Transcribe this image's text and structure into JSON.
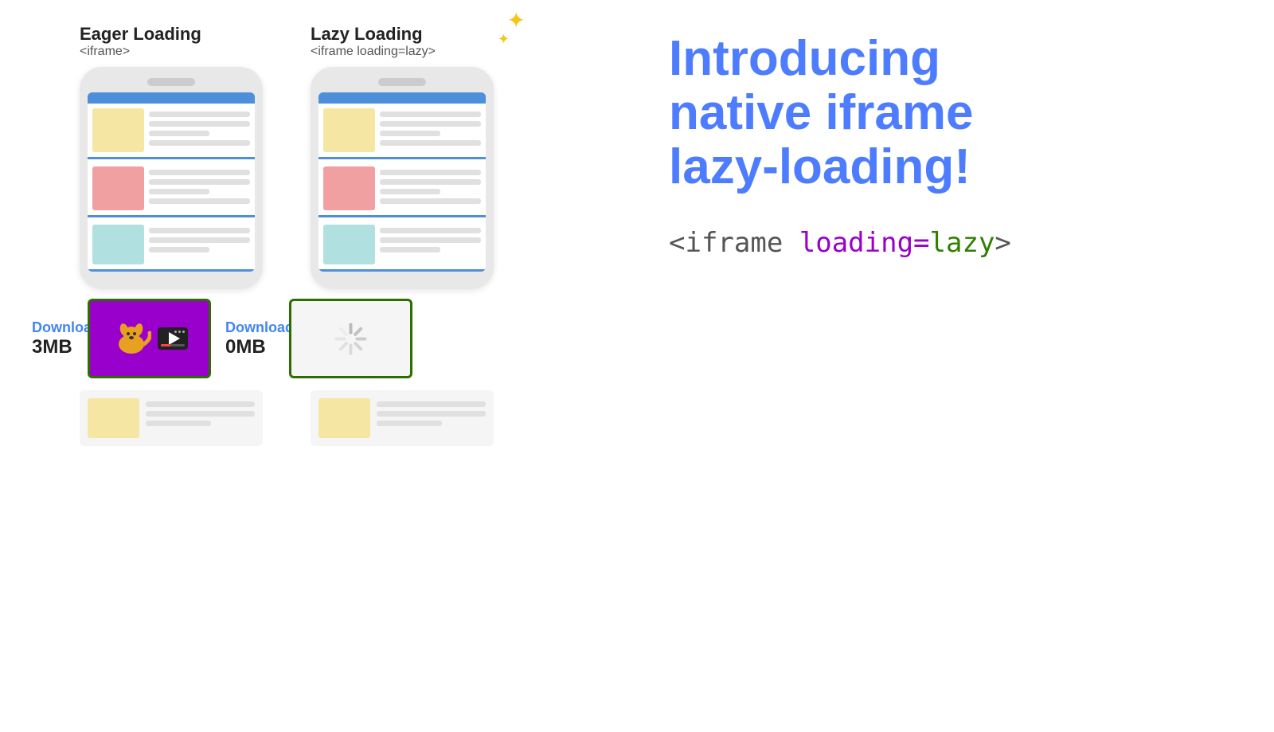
{
  "left": {
    "eager": {
      "title": "Eager Loading",
      "subtitle": "<iframe>"
    },
    "lazy": {
      "title": "Lazy Loading",
      "subtitle": "<iframe loading=lazy>"
    },
    "downloads_eager_label": "Downloads",
    "downloads_eager_size": "3MB",
    "downloads_lazy_label": "Downloads",
    "downloads_lazy_size": "0MB"
  },
  "right": {
    "headline_line1": "Introducing",
    "headline_line2": "native iframe",
    "headline_line3": "lazy-loading!",
    "code_prefix": "<iframe ",
    "code_attr": "loading=",
    "code_value": "lazy",
    "code_suffix": ">"
  },
  "sparkle": "✦"
}
